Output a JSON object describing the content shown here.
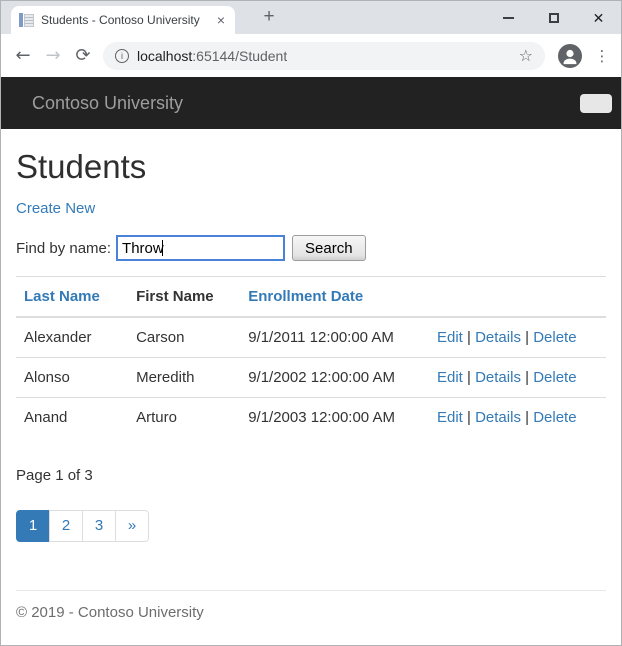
{
  "browser": {
    "tab_title": "Students - Contoso University",
    "url": {
      "host": "localhost",
      "path": ":65144/Student"
    }
  },
  "icons": {
    "back": "←",
    "forward": "→",
    "refresh": "⟳",
    "info": "i",
    "star": "☆",
    "menu": "⋮",
    "new_tab": "+",
    "tab_close": "×",
    "window_close": "✕"
  },
  "navbar": {
    "brand": "Contoso University"
  },
  "page": {
    "title": "Students",
    "create_link": "Create New",
    "search": {
      "label": "Find by name:",
      "value": "Throw",
      "button_label": "Search"
    },
    "table": {
      "headers": {
        "last_name": "Last Name",
        "first_name": "First Name",
        "enrollment_date": "Enrollment Date"
      },
      "rows": [
        {
          "last_name": "Alexander",
          "first_name": "Carson",
          "enrollment_date": "9/1/2011 12:00:00 AM"
        },
        {
          "last_name": "Alonso",
          "first_name": "Meredith",
          "enrollment_date": "9/1/2002 12:00:00 AM"
        },
        {
          "last_name": "Anand",
          "first_name": "Arturo",
          "enrollment_date": "9/1/2003 12:00:00 AM"
        }
      ],
      "row_actions": {
        "edit": "Edit",
        "details": "Details",
        "delete": "Delete",
        "separator": "|"
      }
    },
    "page_info": "Page 1 of 3",
    "pagination": {
      "page1": "1",
      "page2": "2",
      "page3": "3",
      "next": "»",
      "current_page": "1"
    },
    "footer": "© 2019 - Contoso University"
  },
  "colors": {
    "link": "#337ab7",
    "navbar_bg": "#222222",
    "pagination_active_bg": "#337ab7",
    "table_border": "#dddddd",
    "input_focus_border": "#4a82d7"
  }
}
